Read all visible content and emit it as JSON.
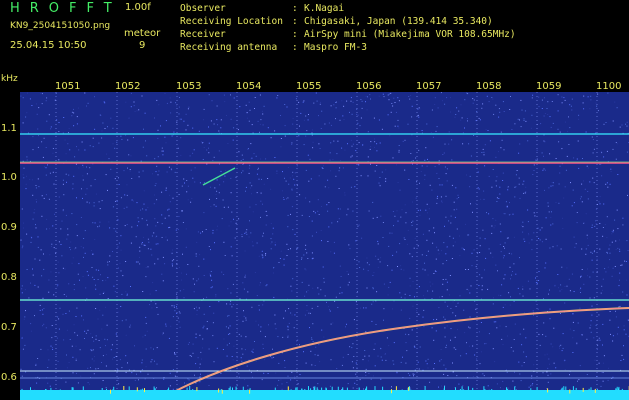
{
  "header": {
    "logo": "HROFFT",
    "version": "1.00f",
    "filename": "KN9_2504151050.png",
    "meteor_label": "meteor",
    "timestamp": "25.04.15 10:50",
    "meteor_count": "9",
    "info": [
      {
        "key": "Observer",
        "value": "K.Nagai"
      },
      {
        "key": "Receiving Location",
        "value": "Chigasaki, Japan (139.414 35.340)"
      },
      {
        "key": "Receiver",
        "value": "AirSpy mini (Miakejima VOR 108.65MHz)"
      },
      {
        "key": "Receiving antenna",
        "value": "Maspro FM-3"
      }
    ]
  },
  "axes": {
    "freq_unit": "kHz",
    "time_labels": [
      "1051",
      "1052",
      "1053",
      "1054",
      "1055",
      "1056",
      "1057",
      "1058",
      "1059",
      "1100"
    ],
    "freq_labels": [
      "1.1",
      "1.0",
      "0.9",
      "0.8",
      "0.7",
      "0.6"
    ]
  },
  "colors": {
    "background": "#1a2a8a",
    "label": "#e8e860",
    "logo": "#44ee66",
    "noise_band": "#22ddff"
  }
}
